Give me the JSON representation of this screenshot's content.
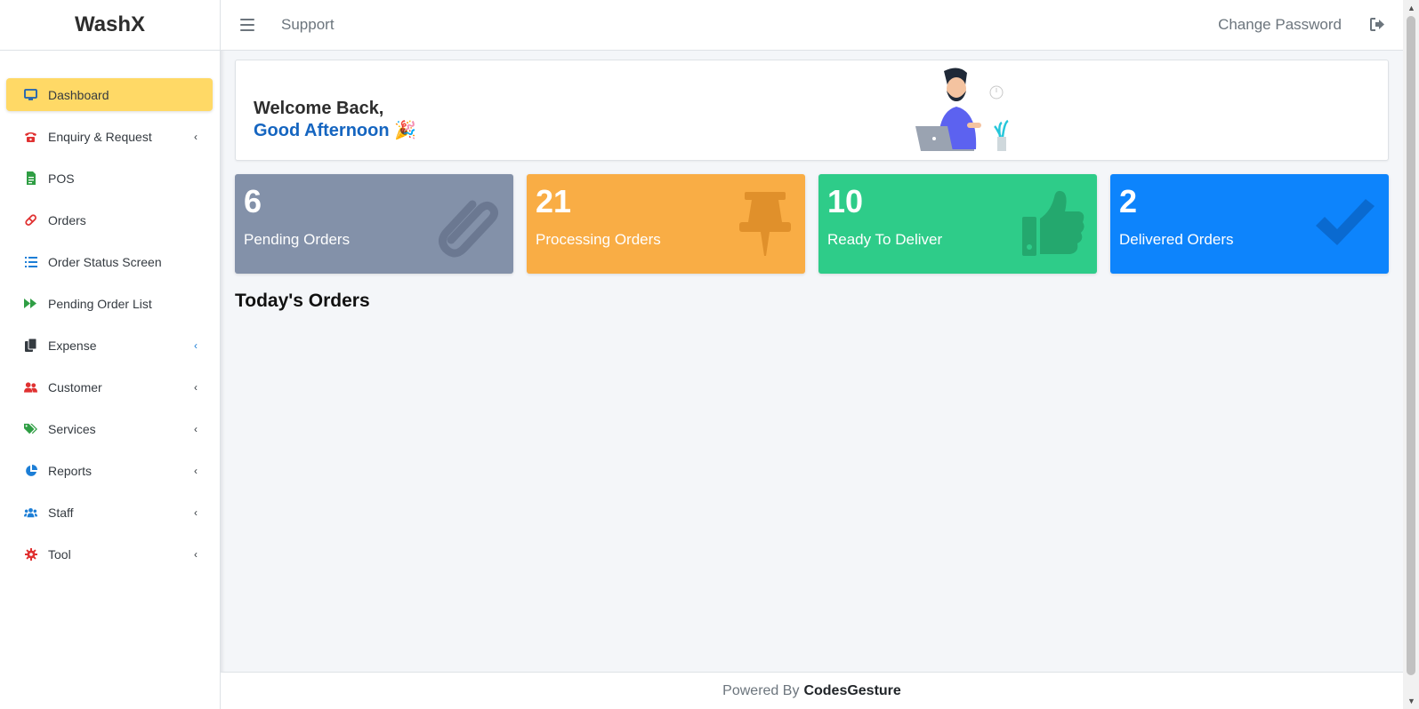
{
  "brand": "WashX",
  "sidebar": {
    "items": [
      {
        "label": "Dashboard",
        "icon": "monitor-icon",
        "active": true,
        "caret": false
      },
      {
        "label": "Enquiry & Request",
        "icon": "fax-icon",
        "caret": true
      },
      {
        "label": "POS",
        "icon": "invoice-icon",
        "caret": false
      },
      {
        "label": "Orders",
        "icon": "pill-icon",
        "caret": false
      },
      {
        "label": "Order Status Screen",
        "icon": "list-icon",
        "caret": false
      },
      {
        "label": "Pending Order List",
        "icon": "fast-forward-icon",
        "caret": false
      },
      {
        "label": "Expense",
        "icon": "copy-icon",
        "caret": true
      },
      {
        "label": "Customer",
        "icon": "users-icon",
        "caret": true
      },
      {
        "label": "Services",
        "icon": "tags-icon",
        "caret": true
      },
      {
        "label": "Reports",
        "icon": "pie-chart-icon",
        "caret": true
      },
      {
        "label": "Staff",
        "icon": "users-group-icon",
        "caret": true
      },
      {
        "label": "Tool",
        "icon": "gear-icon",
        "caret": true
      }
    ],
    "caret_glyph": "‹"
  },
  "topbar": {
    "support": "Support",
    "change_password": "Change Password"
  },
  "welcome": {
    "line1": "Welcome Back,",
    "line2": "Good Afternoon",
    "emoji": "🎉"
  },
  "cards": [
    {
      "count": "6",
      "label": "Pending Orders",
      "color": "#8391a9",
      "icon": "paperclip-icon"
    },
    {
      "count": "21",
      "label": "Processing Orders",
      "color": "#f9ad45",
      "icon": "thumbtack-icon"
    },
    {
      "count": "10",
      "label": "Ready To Deliver",
      "color": "#2ecc89",
      "icon": "thumbs-up-icon"
    },
    {
      "count": "2",
      "label": "Delivered Orders",
      "color": "#0d84fc",
      "icon": "check-icon"
    }
  ],
  "today_orders_title": "Today's Orders",
  "footer": {
    "powered_by": "Powered By",
    "company": "CodesGesture"
  },
  "colors": {
    "active_nav": "#ffd966",
    "accent_blue": "#1565c0"
  }
}
